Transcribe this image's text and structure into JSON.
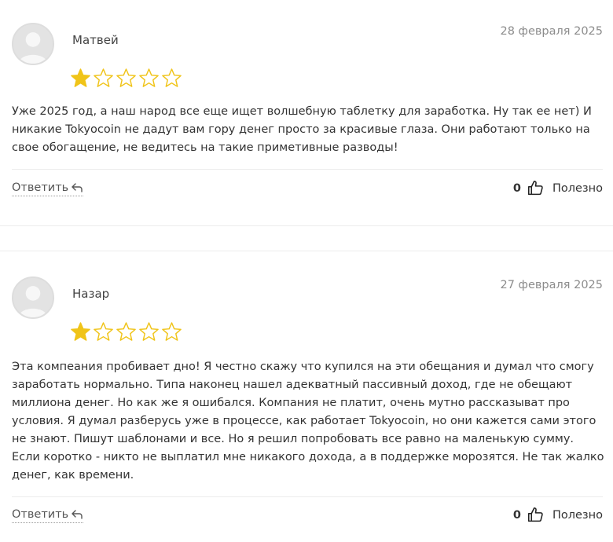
{
  "reviews": [
    {
      "author": "Матвей",
      "date": "28 февраля 2025",
      "rating": 1,
      "max_rating": 5,
      "text": "Уже 2025 год, а наш народ все еще ищет волшебную таблетку для заработка. Ну так ее нет) И никакие Tokyocoin не дадут вам гору денег просто за красивые глаза. Они работают только на свое обогащение, не ведитесь на такие приметивные разводы!",
      "reply_label": "Ответить",
      "helpful_count": "0",
      "helpful_label": "Полезно"
    },
    {
      "author": "Назар",
      "date": "27 февраля 2025",
      "rating": 1,
      "max_rating": 5,
      "text": "Эта компеания пробивает дно! Я честно скажу что купился на эти обещания и думал что смогу заработать нормально. Типа наконец нашел адекватный пассивный доход, где не обещают миллиона денег. Но как же я ошибался. Компания не платит, очень мутно рассказыват про условия. Я думал разберусь уже в процессе, как работает Tokyocoin, но они кажется сами этого не знают. Пишут шаблонами и все. Но я решил попробовать все равно на маленькую сумму. Если коротко - никто не выплатил мне никакого дохода, а в поддержке морозятся. Не так жалко денег, как времени.",
      "reply_label": "Ответить",
      "helpful_count": "0",
      "helpful_label": "Полезно"
    }
  ],
  "colors": {
    "star_filled": "#f0c419",
    "star_outline": "#f0c419",
    "date": "#8c8c8c",
    "divider": "#ececec"
  },
  "icons": {
    "avatar": "user-placeholder-icon",
    "reply": "reply-arrow-icon",
    "helpful": "thumbs-up-icon",
    "star": "star-icon"
  }
}
